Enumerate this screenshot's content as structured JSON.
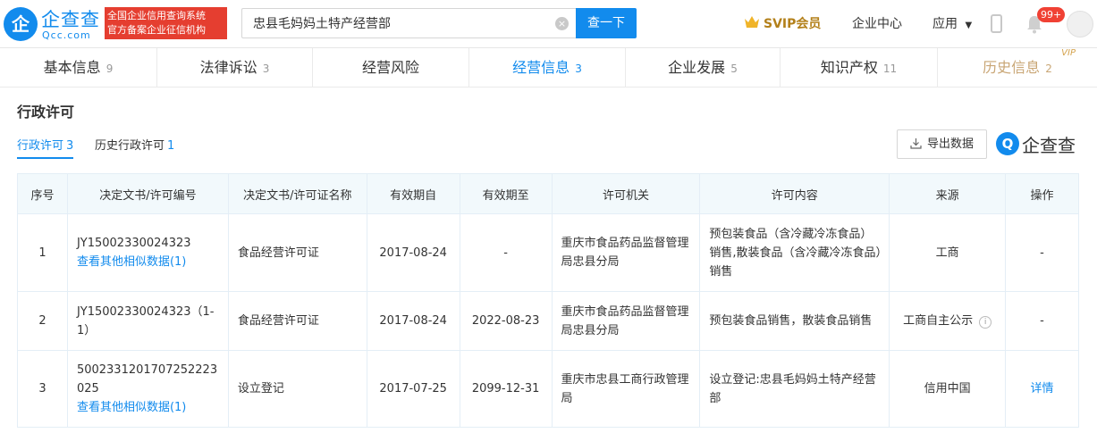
{
  "header": {
    "logo_cn": "企查查",
    "logo_en": "Qcc.com",
    "logo_mark": "企",
    "badge_line1": "全国企业信用查询系统",
    "badge_line2": "官方备案企业征信机构",
    "search_value": "忠县毛妈妈土特产经营部",
    "search_button": "查一下",
    "svip_label": "SVIP会员",
    "enterprise_center": "企业中心",
    "apps_label": "应用",
    "notification_count": "99+",
    "accent_color": "#128bed"
  },
  "tabs": [
    {
      "label": "基本信息",
      "count": "9"
    },
    {
      "label": "法律诉讼",
      "count": "3"
    },
    {
      "label": "经营风险",
      "count": ""
    },
    {
      "label": "经营信息",
      "count": "3"
    },
    {
      "label": "企业发展",
      "count": "5"
    },
    {
      "label": "知识产权",
      "count": "11"
    },
    {
      "label": "历史信息",
      "count": "2",
      "badge": "VIP"
    }
  ],
  "section": {
    "title": "行政许可",
    "subtabs": [
      {
        "label": "行政许可",
        "count": "3"
      },
      {
        "label": "历史行政许可",
        "count": "1"
      }
    ],
    "export_label": "导出数据",
    "brand_text": "企查查"
  },
  "table": {
    "headers": [
      "序号",
      "决定文书/许可编号",
      "决定文书/许可证名称",
      "有效期自",
      "有效期至",
      "许可机关",
      "许可内容",
      "来源",
      "操作"
    ],
    "rows": [
      {
        "no": "1",
        "doc_no": "JY15002330024323",
        "doc_link": "查看其他相似数据(1)",
        "doc_name": "食品经营许可证",
        "valid_from": "2017-08-24",
        "valid_to": "-",
        "authority": "重庆市食品药品监督管理局忠县分局",
        "content": "预包装食品（含冷藏冷冻食品）销售,散装食品（含冷藏冷冻食品）销售",
        "source": "工商",
        "action": "-"
      },
      {
        "no": "2",
        "doc_no": "JY15002330024323（1-1）",
        "doc_link": "",
        "doc_name": "食品经营许可证",
        "valid_from": "2017-08-24",
        "valid_to": "2022-08-23",
        "authority": "重庆市食品药品监督管理局忠县分局",
        "content": "预包装食品销售，散装食品销售",
        "source": "工商自主公示",
        "action": "-"
      },
      {
        "no": "3",
        "doc_no": "5002331201707252223025",
        "doc_link": "查看其他相似数据(1)",
        "doc_name": "设立登记",
        "valid_from": "2017-07-25",
        "valid_to": "2099-12-31",
        "authority": "重庆市忠县工商行政管理局",
        "content": "设立登记:忠县毛妈妈土特产经营部",
        "source": "信用中国",
        "action": "详情"
      }
    ]
  }
}
